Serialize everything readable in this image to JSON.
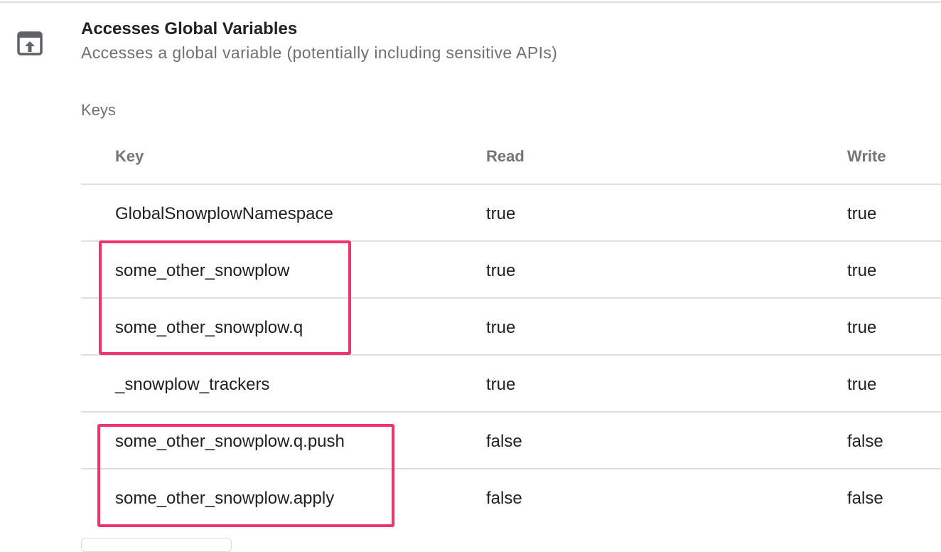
{
  "permission": {
    "title": "Accesses Global Variables",
    "description": "Accesses a global variable (potentially including sensitive APIs)",
    "icon": "open-in-new-up-arrow-icon"
  },
  "keys_label": "Keys",
  "table": {
    "headers": [
      "Key",
      "Read",
      "Write"
    ],
    "rows": [
      {
        "key": "GlobalSnowplowNamespace",
        "read": "true",
        "write": "true"
      },
      {
        "key": "some_other_snowplow",
        "read": "true",
        "write": "true"
      },
      {
        "key": "some_other_snowplow.q",
        "read": "true",
        "write": "true"
      },
      {
        "key": "_snowplow_trackers",
        "read": "true",
        "write": "true"
      },
      {
        "key": "some_other_snowplow.q.push",
        "read": "false",
        "write": "false"
      },
      {
        "key": "some_other_snowplow.apply",
        "read": "false",
        "write": "false"
      }
    ]
  },
  "highlight_color": "#f0346c"
}
